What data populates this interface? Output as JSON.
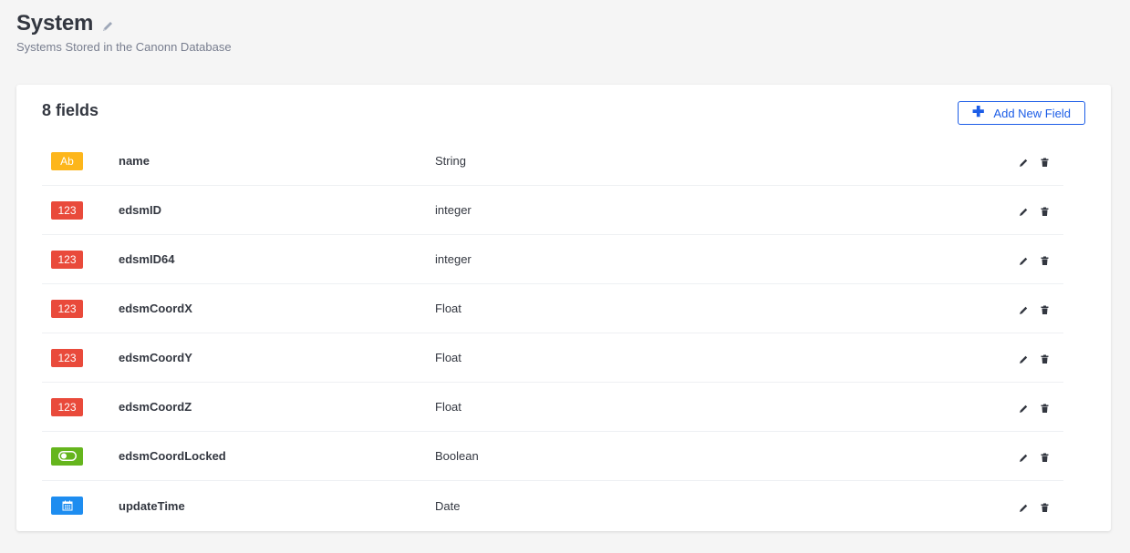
{
  "header": {
    "title": "System",
    "subtitle": "Systems Stored in the Canonn Database"
  },
  "card": {
    "fields_count": "8 fields",
    "add_button_label": "Add New Field"
  },
  "colors": {
    "accent": "#1c5de7",
    "string_badge": "#fdb61b",
    "number_badge": "#e94a3b",
    "boolean_badge": "#65b51d",
    "date_badge": "#1e8df0"
  },
  "fields": [
    {
      "badge": "Ab",
      "badge_kind": "string",
      "name": "name",
      "type": "String"
    },
    {
      "badge": "123",
      "badge_kind": "number",
      "name": "edsmID",
      "type": "integer"
    },
    {
      "badge": "123",
      "badge_kind": "number",
      "name": "edsmID64",
      "type": "integer"
    },
    {
      "badge": "123",
      "badge_kind": "number",
      "name": "edsmCoordX",
      "type": "Float"
    },
    {
      "badge": "123",
      "badge_kind": "number",
      "name": "edsmCoordY",
      "type": "Float"
    },
    {
      "badge": "123",
      "badge_kind": "number",
      "name": "edsmCoordZ",
      "type": "Float"
    },
    {
      "badge": "",
      "badge_kind": "bool",
      "badge_icon": "toggle-icon",
      "name": "edsmCoordLocked",
      "type": "Boolean"
    },
    {
      "badge": "",
      "badge_kind": "date",
      "badge_icon": "calendar-icon",
      "name": "updateTime",
      "type": "Date"
    }
  ]
}
